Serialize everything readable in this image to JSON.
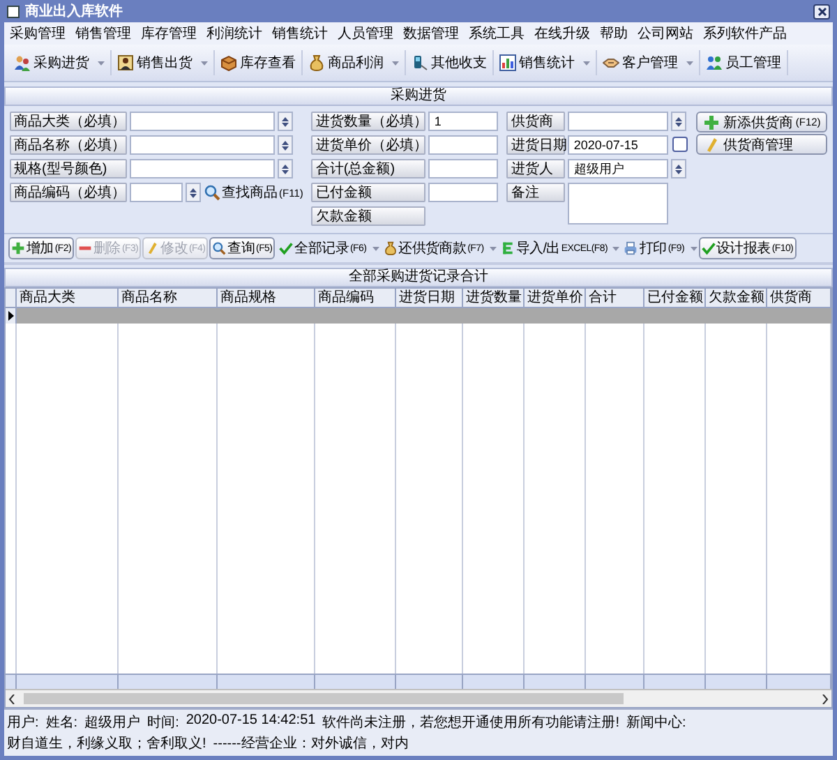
{
  "window": {
    "title": "商业出入库软件"
  },
  "menu": [
    "采购管理",
    "销售管理",
    "库存管理",
    "利润统计",
    "销售统计",
    "人员管理",
    "数据管理",
    "系统工具",
    "在线升级",
    "帮助",
    "公司网站",
    "系列软件产品"
  ],
  "toolbar": [
    {
      "label": "采购进货",
      "dropdown": true
    },
    {
      "label": "销售出货",
      "dropdown": true
    },
    {
      "label": "库存查看",
      "dropdown": false
    },
    {
      "label": "商品利润",
      "dropdown": true
    },
    {
      "label": "其他收支",
      "dropdown": false
    },
    {
      "label": "销售统计",
      "dropdown": true
    },
    {
      "label": "客户管理",
      "dropdown": true
    },
    {
      "label": "员工管理",
      "dropdown": false
    }
  ],
  "form": {
    "title": "采购进货",
    "columns": [
      [
        {
          "label": "商品大类（必填）",
          "kind": "combo"
        },
        {
          "label": "商品名称（必填）",
          "kind": "combo"
        },
        {
          "label": "规格(型号颜色)",
          "kind": "combo"
        },
        {
          "label": "商品编码（必填）",
          "kind": "search",
          "action": "查找商品",
          "key": "(F11)"
        }
      ],
      [
        {
          "label": "进货数量（必填）",
          "kind": "text",
          "value": "1"
        },
        {
          "label": "进货单价（必填）",
          "kind": "text"
        },
        {
          "label": "合计(总金额)",
          "kind": "text"
        },
        {
          "label": "已付金额",
          "kind": "text"
        },
        {
          "label": "欠款金额",
          "kind": "none"
        }
      ],
      [
        {
          "label": "供货商",
          "kind": "combo"
        },
        {
          "label": "进货日期",
          "kind": "date",
          "value": "2020-07-15"
        },
        {
          "label": "进货人",
          "kind": "combo",
          "value": "超级用户"
        },
        {
          "label": "备注",
          "kind": "memo"
        }
      ]
    ],
    "side_buttons": [
      {
        "label": "新添供货商",
        "key": "(F12)"
      },
      {
        "label": "供货商管理"
      }
    ]
  },
  "actions": [
    {
      "label": "增加",
      "key": "(F2)",
      "kind": "button",
      "disabled": false
    },
    {
      "label": "删除",
      "key": "(F3)",
      "kind": "button",
      "disabled": true
    },
    {
      "label": "修改",
      "key": "(F4)",
      "kind": "button",
      "disabled": true
    },
    {
      "label": "查询",
      "key": "(F5)",
      "kind": "button",
      "disabled": false
    },
    {
      "label": "全部记录",
      "key": "(F6)",
      "kind": "menu",
      "disabled": false
    },
    {
      "label": "还供货商款",
      "key": "(F7)",
      "kind": "menu",
      "disabled": false
    },
    {
      "label": "导入/出",
      "key": "EXCEL(F8)",
      "kind": "menu",
      "disabled": false
    },
    {
      "label": "打印",
      "key": "(F9)",
      "kind": "menu",
      "disabled": false
    },
    {
      "label": "设计报表",
      "key": "(F10)",
      "kind": "button",
      "disabled": false
    }
  ],
  "table": {
    "title": "全部采购进货记录合计",
    "columns": [
      "商品大类",
      "商品名称",
      "商品规格",
      "商品编码",
      "进货日期",
      "进货数量",
      "进货单价",
      "合计",
      "已付金额",
      "欠款金额",
      "供货商"
    ],
    "rows": [
      {
        "selected": true
      }
    ]
  },
  "status_bar": [
    "用户:",
    "姓名:",
    "超级用户",
    "时间:",
    "2020-07-15 14:42:51",
    "软件尚未注册，若您想开通使用所有功能请注册!",
    "新闻中心:",
    "财自道生，利缘义取；舍利取义!",
    "------经营企业：对外诚信，对内"
  ]
}
